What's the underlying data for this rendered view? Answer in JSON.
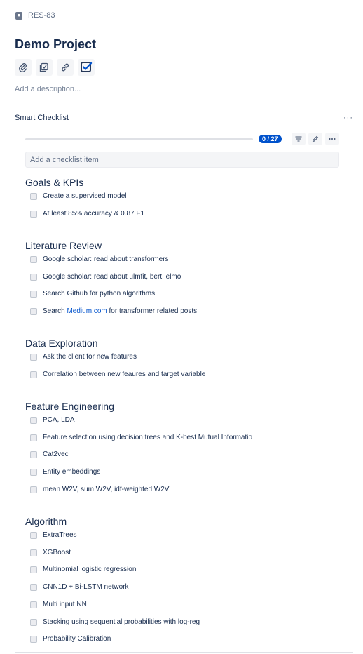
{
  "issue": {
    "key": "RES-83",
    "title": "Demo Project",
    "description_placeholder": "Add a description..."
  },
  "actions": [
    {
      "icon": "attachment-icon"
    },
    {
      "icon": "subtask-icon"
    },
    {
      "icon": "link-icon"
    },
    {
      "icon": "checklist-icon"
    }
  ],
  "checklist": {
    "section_title": "Smart Checklist",
    "more_label": "···",
    "progress_label": "0 / 27",
    "progress_fraction": 0,
    "add_placeholder": "Add a checklist item",
    "groups": [
      {
        "title": "Goals & KPIs",
        "items": [
          "Create a supervised model",
          "At least 85% accuracy & 0.87 F1"
        ]
      },
      {
        "title": "Literature Review",
        "items": [
          "Google scholar: read about transformers",
          "Google scholar: read about ulmfit, bert, elmo",
          "Search Github for python algorithms"
        ],
        "link_item": {
          "pre": "Search ",
          "link": "Medium.com",
          "post": " for transformer related posts"
        }
      },
      {
        "title": "Data Exploration",
        "items": [
          "Ask the client for new features",
          "Correlation between new feaures and target variable"
        ]
      },
      {
        "title": "Feature Engineering",
        "items": [
          "PCA, LDA",
          "Feature selection using decision trees and K-best Mutual Informatio",
          "Cat2vec",
          "Entity embeddings",
          "mean W2V, sum W2V, idf-weighted W2V"
        ]
      },
      {
        "title": "Algorithm",
        "items": [
          "ExtraTrees",
          "XGBoost",
          "Multinomial logistic regression",
          "CNN1D + Bi-LSTM network",
          "Multi input NN",
          "Stacking using sequential probabilities with log-reg",
          "Probability Calibration"
        ]
      }
    ]
  }
}
